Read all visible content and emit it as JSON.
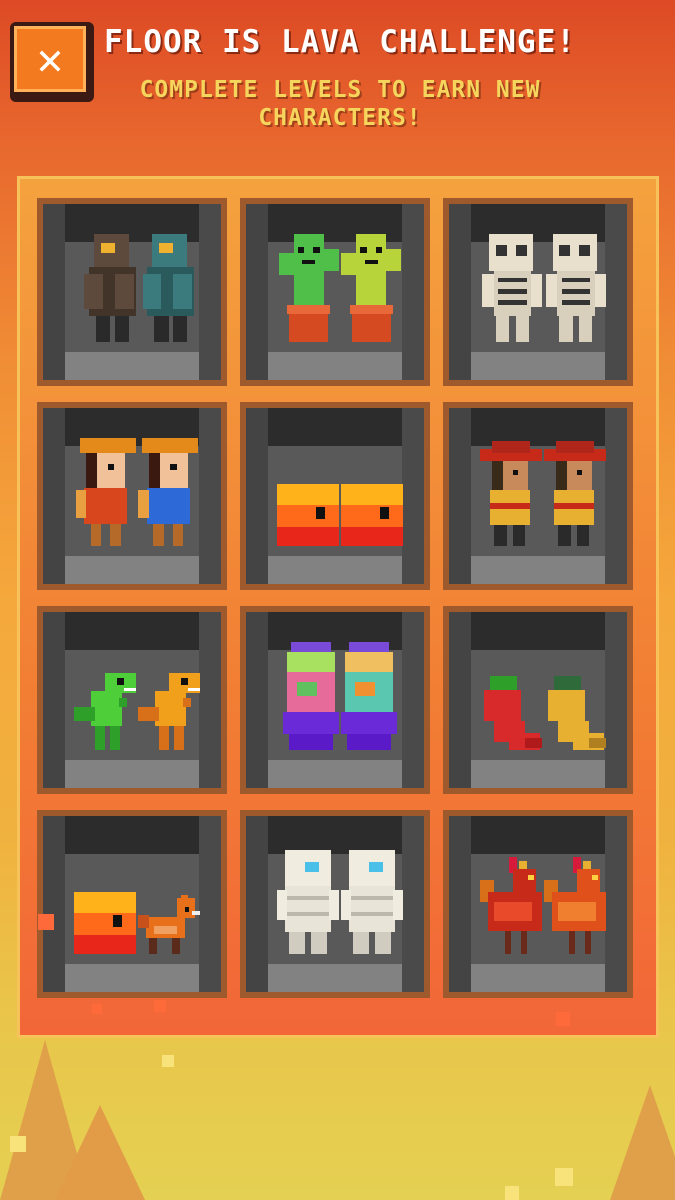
{
  "header": {
    "close_icon": "close-x-icon",
    "title": "FLOOR IS LAVA CHALLENGE!",
    "subtitle": "COMPLETE LEVELS TO EARN NEW CHARACTERS!"
  },
  "colors": {
    "bg_top": "#dd4a25",
    "bg_bottom": "#e4d052",
    "title": "#ffffff",
    "subtitle": "#f6d55c",
    "shelf_frame": "#9e5a2c",
    "cell_bg": "#3a3a3a"
  },
  "characters": [
    {
      "name": "robot-pair",
      "pair": [
        "brown robot",
        "teal robot"
      ]
    },
    {
      "name": "cactus-pair",
      "pair": [
        "green cactus",
        "yellow cactus"
      ]
    },
    {
      "name": "skeleton-pair",
      "pair": [
        "skeleton",
        "skeleton"
      ]
    },
    {
      "name": "explorer-pair",
      "pair": [
        "red explorer",
        "blue explorer"
      ]
    },
    {
      "name": "lava-blob-pair",
      "pair": [
        "lava blob",
        "lava blob"
      ]
    },
    {
      "name": "firefighter-pair",
      "pair": [
        "firefighter",
        "firefighter"
      ]
    },
    {
      "name": "dino-pair",
      "pair": [
        "green dino",
        "orange dino"
      ]
    },
    {
      "name": "lava-lamp-pair",
      "pair": [
        "pink lava lamp",
        "teal lava lamp"
      ]
    },
    {
      "name": "pepper-pair",
      "pair": [
        "red pepper",
        "yellow pepper"
      ]
    },
    {
      "name": "blob-fox-pair",
      "pair": [
        "lava blob",
        "fox"
      ]
    },
    {
      "name": "mummy-pair",
      "pair": [
        "mummy",
        "mummy"
      ]
    },
    {
      "name": "phoenix-pair",
      "pair": [
        "red phoenix",
        "orange phoenix"
      ]
    }
  ]
}
